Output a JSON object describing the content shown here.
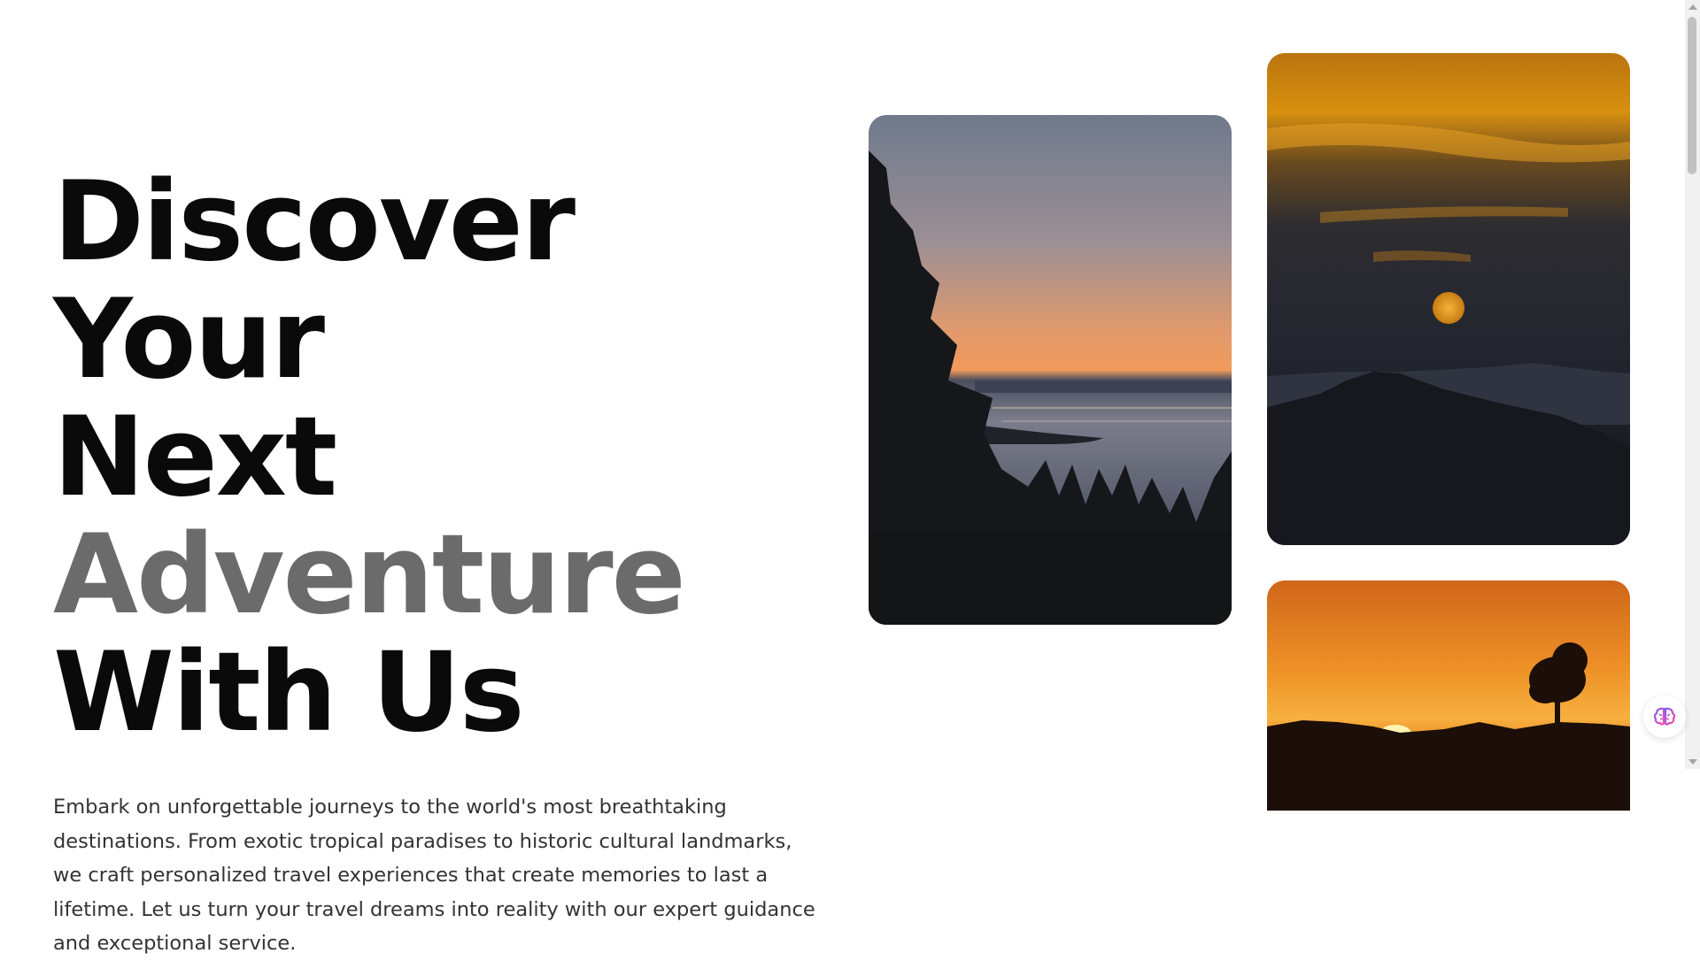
{
  "hero": {
    "headline_line1": "Discover Your",
    "headline_line2_part1": "Next",
    "headline_line2_accent": "Adventure",
    "headline_line3": "With Us",
    "description": "Embark on unforgettable journeys to the world's most breathtaking destinations. From exotic tropical paradises to historic cultural landmarks, we craft personalized travel experiences that create memories to last a lifetime. Let us turn your travel dreams into reality with our expert guidance and exceptional service."
  },
  "gallery": {
    "photos": [
      {
        "subject": "lake-sunset-with-pine-trees"
      },
      {
        "subject": "sunset-over-mountain-ridge"
      },
      {
        "subject": "savanna-sunset-with-tree"
      }
    ]
  },
  "widgets": {
    "assistant_icon": "brain-icon"
  },
  "colors": {
    "headline": "#0a0a0a",
    "accent": "#6b6b6b",
    "body_text": "#333333",
    "background": "#ffffff"
  }
}
